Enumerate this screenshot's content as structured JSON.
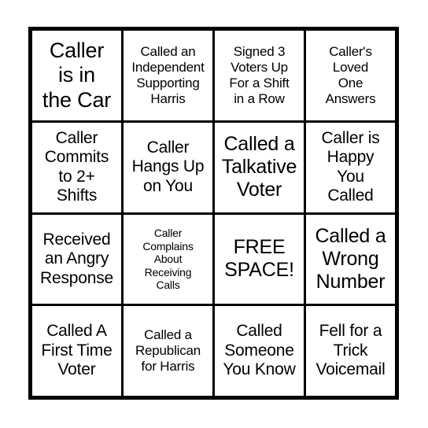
{
  "card": {
    "type": "bingo-card",
    "rows": 4,
    "columns": 4,
    "border_color": "#000000",
    "background_color": "#ffffff",
    "text_color": "#000000",
    "cells": [
      {
        "text": "Caller\nis in\nthe Car",
        "size": "xl",
        "free_space": false
      },
      {
        "text": "Called an\nIndependent\nSupporting\nHarris",
        "size": "sm",
        "free_space": false
      },
      {
        "text": "Signed 3\nVoters Up\nFor a Shift\nin a Row",
        "size": "sm",
        "free_space": false
      },
      {
        "text": "Caller's\nLoved\nOne\nAnswers",
        "size": "sm",
        "free_space": false
      },
      {
        "text": "Caller\nCommits\nto 2+\nShifts",
        "size": "md",
        "free_space": false
      },
      {
        "text": "Caller\nHangs Up\non You",
        "size": "md",
        "free_space": false
      },
      {
        "text": "Called a\nTalkative\nVoter",
        "size": "lg",
        "free_space": false
      },
      {
        "text": "Caller is\nHappy\nYou\nCalled",
        "size": "md",
        "free_space": false
      },
      {
        "text": "Received\nan Angry\nResponse",
        "size": "md",
        "free_space": false
      },
      {
        "text": "Caller\nComplains\nAbout\nReceiving\nCalls",
        "size": "xs",
        "free_space": false
      },
      {
        "text": "FREE\nSPACE!",
        "size": "lg",
        "free_space": true
      },
      {
        "text": "Called a\nWrong\nNumber",
        "size": "lg",
        "free_space": false
      },
      {
        "text": "Called A\nFirst Time\nVoter",
        "size": "md",
        "free_space": false
      },
      {
        "text": "Called a\nRepublican\nfor Harris",
        "size": "sm",
        "free_space": false
      },
      {
        "text": "Called\nSomeone\nYou Know",
        "size": "md",
        "free_space": false
      },
      {
        "text": "Fell for a\nTrick\nVoicemail",
        "size": "md",
        "free_space": false
      }
    ]
  }
}
